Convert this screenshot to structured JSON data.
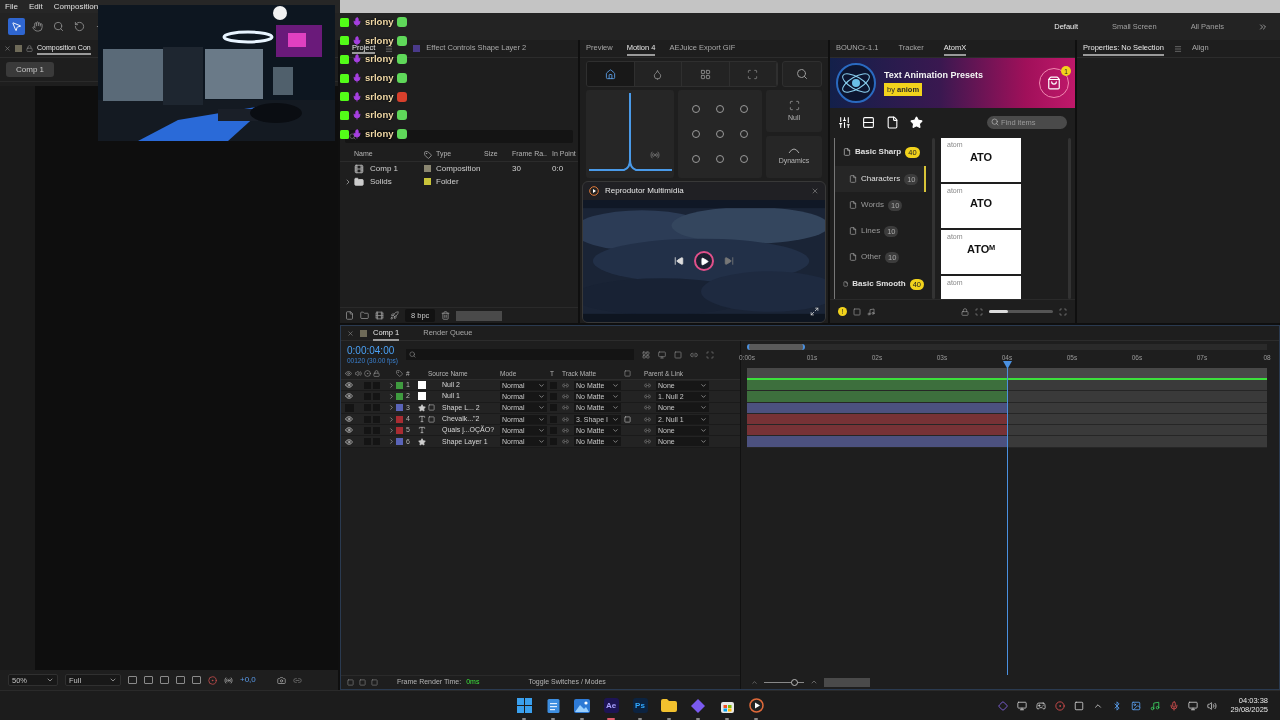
{
  "menu": [
    "File",
    "Edit",
    "Composition"
  ],
  "tools": [
    {
      "kind": "selection",
      "selected": true
    },
    {
      "kind": "hand",
      "selected": false
    },
    {
      "kind": "zoom",
      "selected": false
    },
    {
      "kind": "rotate",
      "selected": false
    },
    {
      "kind": "plus",
      "selected": false
    }
  ],
  "workspaces": [
    {
      "label": "Default",
      "selected": true
    },
    {
      "label": "Small Screen",
      "selected": false
    },
    {
      "label": "All Panels",
      "selected": false
    }
  ],
  "webcam": {
    "kind": "picture"
  },
  "chat": [
    {
      "name": "srlony",
      "color": "#5fd85a"
    },
    {
      "name": "srlony",
      "color": "#5fd85a"
    },
    {
      "name": "srlony",
      "color": "#5fd85a"
    },
    {
      "name": "srlony",
      "color": "#5fd85a"
    },
    {
      "name": "srlony",
      "color": "#d8402c"
    },
    {
      "name": "srlony",
      "color": "#5fd85a"
    },
    {
      "name": "srlony",
      "color": "#5fd85a"
    }
  ],
  "composition_panel": {
    "tab": "Composition Con",
    "comp": "Comp 1",
    "zoom": "50%",
    "resolution": "Full",
    "exposure": "+0,0"
  },
  "project_panel": {
    "tabs": [
      "Project",
      "Effect Controls Shape Layer 2"
    ],
    "columns": [
      "Name",
      "Type",
      "Size",
      "Frame Ra..",
      "In Point"
    ],
    "items": [
      {
        "kind": "composition",
        "name": "Comp 1",
        "color": "#8a8670",
        "type": "Composition",
        "frame_rate": "30",
        "in_point": "0:0"
      },
      {
        "kind": "folder",
        "name": "Solids",
        "color": "#c9c43a",
        "type": "Folder"
      }
    ],
    "bit_depth": "8 bpc"
  },
  "motion_panel": {
    "tabs": [
      {
        "label": "Preview",
        "selected": false
      },
      {
        "label": "Motion 4",
        "selected": true
      },
      {
        "label": "AEJuice Export GIF",
        "selected": false
      }
    ],
    "null_label": "Null",
    "dynamics_label": "Dynamics"
  },
  "media_player": {
    "title": "Reprodutor Multimídia"
  },
  "atomx_panel": {
    "tabs": [
      {
        "label": "BOUNCr-1.1",
        "selected": false
      },
      {
        "label": "Tracker",
        "selected": false
      },
      {
        "label": "AtomX",
        "selected": true
      }
    ],
    "title": "Text Animation Presets",
    "byline": "by **aniom**",
    "cart_count": "1",
    "search_placeholder": "Find items",
    "categories": [
      {
        "label": "Basic Sharp",
        "count": "40",
        "selected": false,
        "children": [
          {
            "label": "Characters",
            "count": "10",
            "selected": true
          },
          {
            "label": "Words",
            "count": "10",
            "selected": false
          },
          {
            "label": "Lines",
            "count": "10",
            "selected": false
          },
          {
            "label": "Other",
            "count": "10",
            "selected": false
          }
        ]
      },
      {
        "label": "Basic Smooth",
        "count": "40",
        "selected": false
      }
    ],
    "presets": [
      {
        "brand": "atom",
        "text": "ATO"
      },
      {
        "brand": "atom",
        "text": "ATO"
      },
      {
        "brand": "atom",
        "text": "ATOᴹ"
      },
      {
        "brand": "atom"
      }
    ],
    "notice": "!",
    "size_slider": {
      "level": 0.3
    }
  },
  "properties_panel": {
    "tabs": [
      "Properties: No Selection",
      "Align"
    ]
  },
  "timeline": {
    "tabs": [
      {
        "label": "Comp 1",
        "selected": true
      },
      {
        "label": "Render Queue",
        "selected": false
      }
    ],
    "timecode": "0:00:04:00",
    "frames": "00120 (30.00 fps)",
    "columns": {
      "number": "#",
      "source": "Source Name",
      "mode": "Mode",
      "t": "T",
      "matte": "Track Matte",
      "parent": "Parent & Link"
    },
    "layers": [
      {
        "number": "1",
        "kind": "null",
        "name": "Null 2",
        "color": "#3f9a3f",
        "visible": true,
        "framed": false,
        "mode": "Normal",
        "matte": "No Matte",
        "linked": false,
        "parent": "None"
      },
      {
        "number": "2",
        "kind": "null",
        "name": "Null 1",
        "color": "#3f9a3f",
        "visible": true,
        "framed": false,
        "mode": "Normal",
        "matte": "No Matte",
        "linked": false,
        "parent": "1. Null 2"
      },
      {
        "number": "3",
        "kind": "shape",
        "name": "Shape L... 2",
        "color": "#5a64b8",
        "visible": false,
        "framed": true,
        "mode": "Normal",
        "matte": "No Matte",
        "linked": false,
        "parent": "None"
      },
      {
        "number": "4",
        "kind": "text",
        "name": "Chevalk...\"2",
        "color": "#a82c32",
        "visible": true,
        "framed": true,
        "mode": "Normal",
        "matte": "3. Shape I",
        "linked": true,
        "parent": "2. Null 1"
      },
      {
        "number": "5",
        "kind": "text",
        "name": "Quais j...OÇÃO?",
        "color": "#a82c32",
        "visible": true,
        "framed": false,
        "mode": "Normal",
        "matte": "No Matte",
        "linked": false,
        "parent": "None"
      },
      {
        "number": "6",
        "kind": "shape",
        "name": "Shape Layer 1",
        "color": "#5a64b8",
        "visible": true,
        "framed": false,
        "mode": "Normal",
        "matte": "No Matte",
        "linked": false,
        "parent": "None"
      }
    ],
    "ruler": [
      "0:00s",
      "01s",
      "02s",
      "03s",
      "04s",
      "05s",
      "06s",
      "07s",
      "08"
    ],
    "playhead": {
      "level": 0.5
    },
    "zoom_slider": {
      "level": 0.75
    },
    "render_label": "Frame Render Time:",
    "render_time": "0ms",
    "toggle": "Toggle Switches / Modes"
  },
  "taskbar": {
    "apps": [
      {
        "kind": "start",
        "selected": false
      },
      {
        "kind": "notepad",
        "selected": false
      },
      {
        "kind": "photos",
        "selected": false
      },
      {
        "kind": "ae",
        "label": "Ae",
        "selected": true
      },
      {
        "kind": "ps",
        "label": "Ps",
        "selected": false
      },
      {
        "kind": "explorer",
        "selected": false
      },
      {
        "kind": "diamond",
        "selected": false
      },
      {
        "kind": "store",
        "selected": false
      },
      {
        "kind": "player",
        "selected": false
      }
    ],
    "time": "04:03:38",
    "date": "29/08/2025"
  }
}
